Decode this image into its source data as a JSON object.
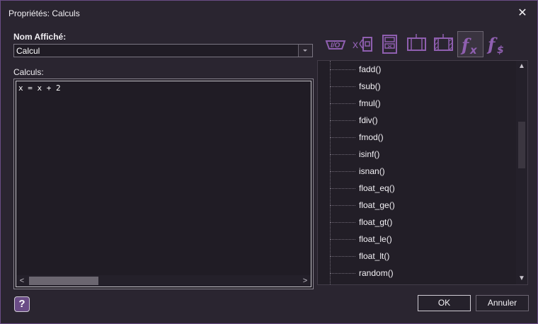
{
  "window": {
    "title": "Propriétés: Calculs",
    "close_glyph": "✕"
  },
  "display_name": {
    "label": "Nom Affiché:",
    "value": "Calcul"
  },
  "calculs": {
    "label": "Calculs:",
    "code": "x = x + 2"
  },
  "editor_scroll": {
    "left_arrow": "<",
    "right_arrow": ">"
  },
  "tabs": [
    {
      "icon": "io-icon",
      "active": false
    },
    {
      "icon": "variable-x-icon",
      "active": false
    },
    {
      "icon": "film-block-icon",
      "active": false
    },
    {
      "icon": "block-icon",
      "active": false
    },
    {
      "icon": "hatched-block-icon",
      "active": false
    },
    {
      "icon": "function-fx-icon",
      "active": true
    },
    {
      "icon": "function-fs-icon",
      "active": false
    }
  ],
  "functions": [
    "fadd()",
    "fsub()",
    "fmul()",
    "fdiv()",
    "fmod()",
    "isinf()",
    "isnan()",
    "float_eq()",
    "float_ge()",
    "float_gt()",
    "float_le()",
    "float_lt()",
    "random()"
  ],
  "tree_scroll": {
    "up_arrow": "▲",
    "down_arrow": "▼"
  },
  "footer": {
    "help": "?",
    "ok": "OK",
    "cancel": "Annuler"
  },
  "colors": {
    "accent": "#7b4e9a",
    "background": "#2a2530",
    "field": "#201c25",
    "border": "#6a4d86"
  }
}
